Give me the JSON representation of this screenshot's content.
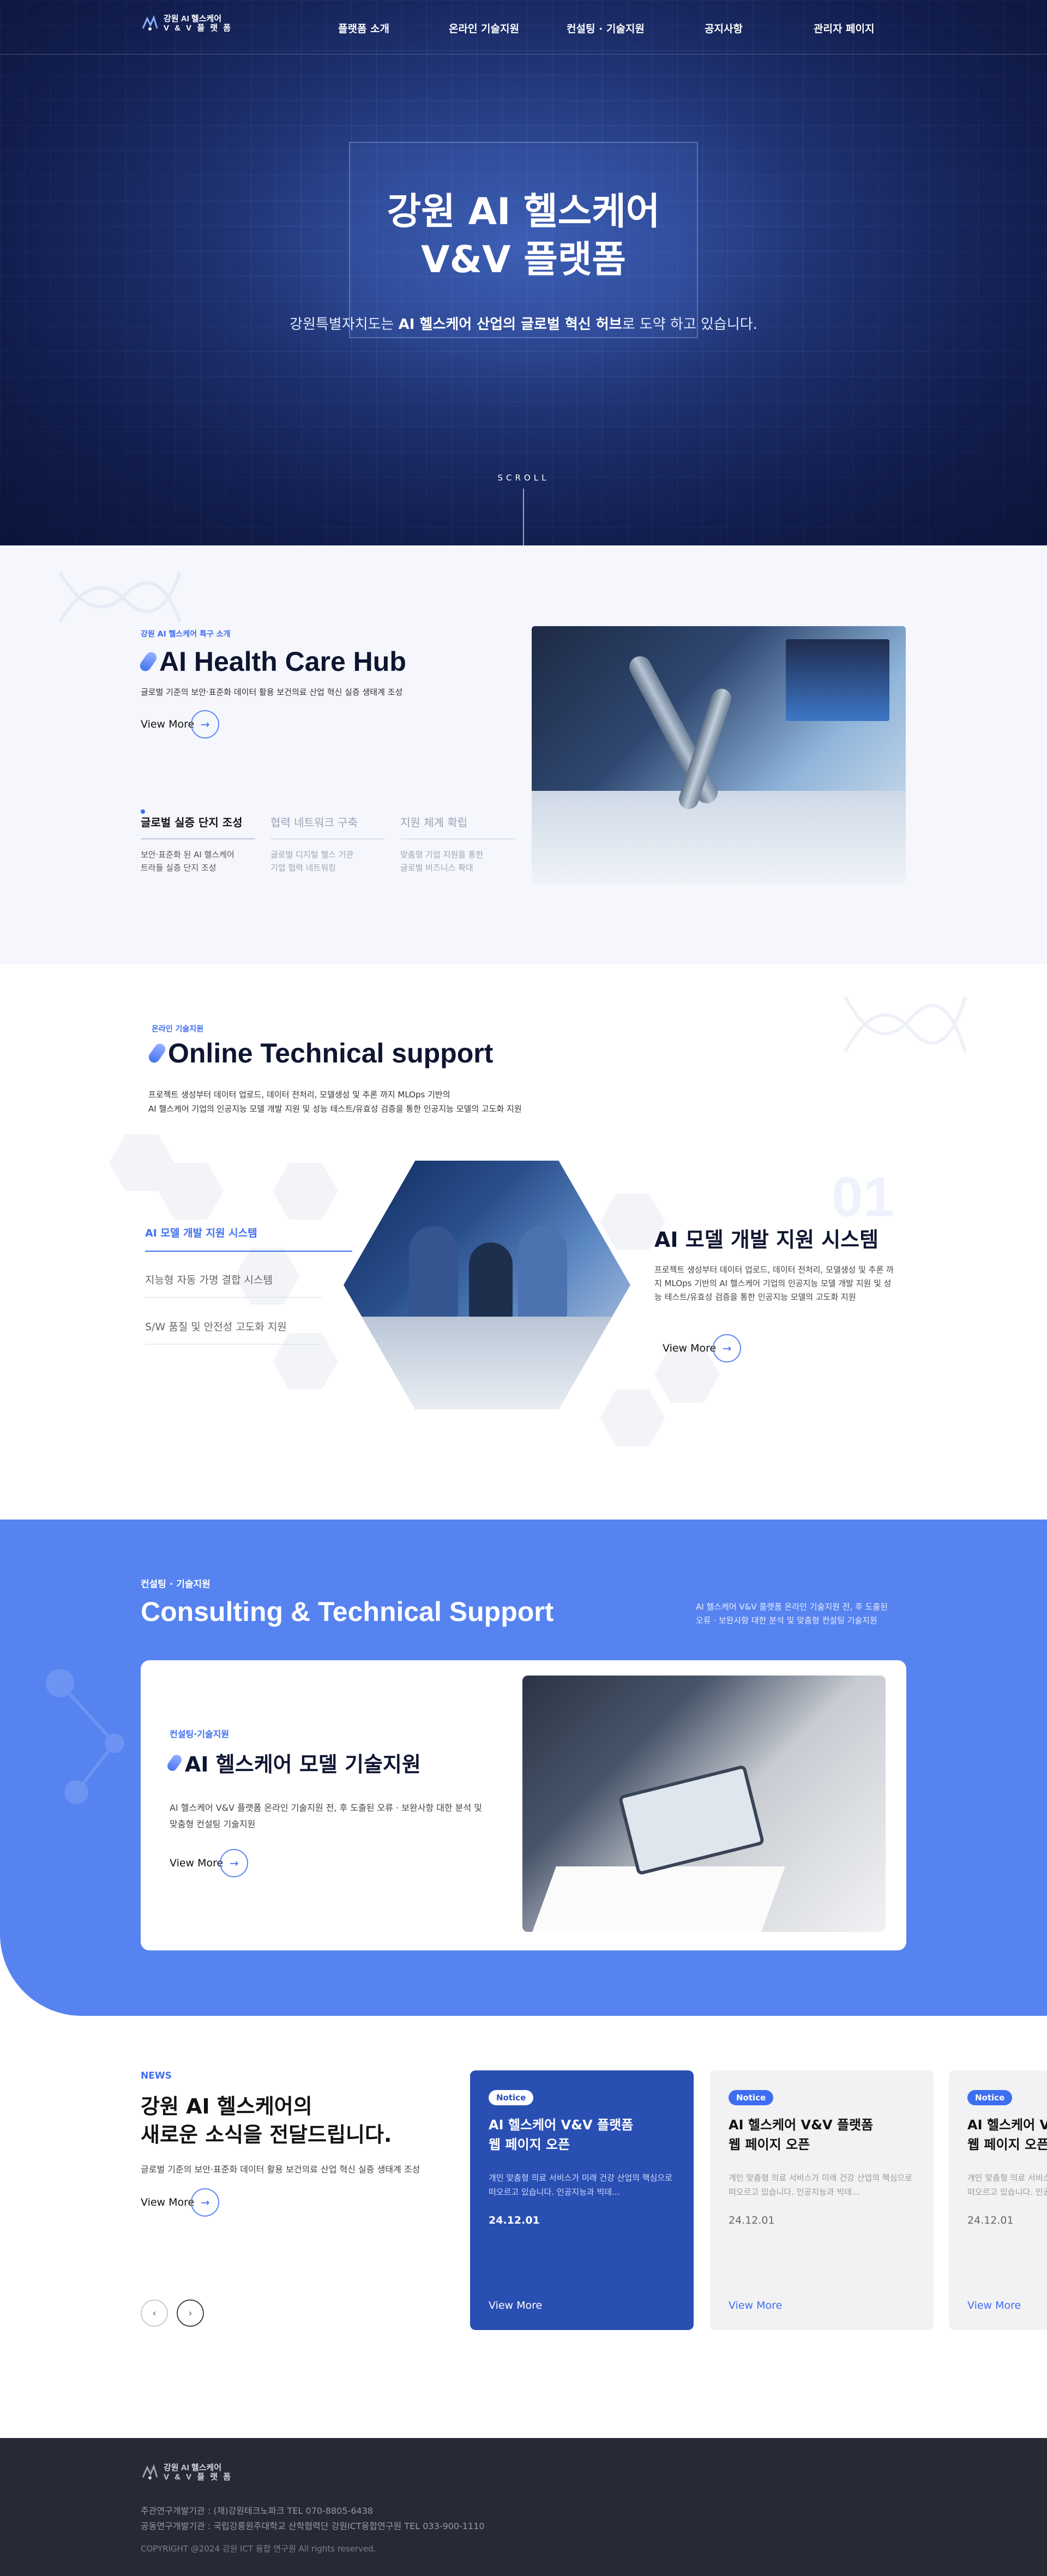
{
  "header": {
    "logo_line1": "강원 AI 헬스케어",
    "logo_line2": "V & V  플 랫 폼",
    "nav": [
      "플랫폼 소개",
      "온라인 기술지원",
      "컨설팅 · 기술지원",
      "공지사항",
      "관리자 페이지"
    ]
  },
  "hero": {
    "title_line1": "강원 AI 헬스케어",
    "title_line2": "V&V 플랫폼",
    "sub_pre": "강원특별자치도는 ",
    "sub_bold": "AI 헬스케어 산업의 글로벌 혁신 허브",
    "sub_post": "로 도약 하고 있습니다.",
    "scroll": "SCROLL"
  },
  "hub": {
    "eyebrow": "강원 AI 헬스케어 특구 소개",
    "title": "AI Health Care Hub",
    "desc": "글로벌 기준의 보안·표준화 데이터 활용 보건의료 산업 혁신 실증 생태계 조성",
    "view_more": "View More",
    "tabs": [
      {
        "title": "글로벌 실증 단지 조성",
        "desc_line1": "보안·표준화 된 AI 헬스케어",
        "desc_line2": "트라들 실증 단지 조성"
      },
      {
        "title": "협력 네트워크 구축",
        "desc_line1": "글로벌 디지털 헬스 기관",
        "desc_line2": "기업 협력 네트워킹"
      },
      {
        "title": "지원 체계 확립",
        "desc_line1": "맞춤형 기업 지원을 통한",
        "desc_line2": "글로벌 비즈니스 확대"
      }
    ]
  },
  "online": {
    "eyebrow": "온라인 기술지원",
    "title": "Online Technical support",
    "desc_line1": "프로젝트 생성부터 데이터 업로드, 데이터 전처리, 모델생성 및 추론 까지 MLOps 기반의",
    "desc_line2": "AI 헬스케어 기업의 인공지능 모델 개발 지원 및 성능 테스트/유효성 검증을 통한 인공지능 모델의 고도화 지원",
    "menu": [
      "AI 모델 개발 지원 시스템",
      "지능형 자동 가명 결합 시스템",
      "S/W 품질 및 안전성 고도화 지원"
    ],
    "number": "01",
    "detail_title": "AI 모델 개발 지원 시스템",
    "detail_desc": "프로젝트 생성부터 데이터 업로드, 데이터 전처리, 모델생성 및 추론 까지 MLOps 기반의 AI 헬스케어 기업의 인공지능 모델 개발 지원 및 성능 테스트/유효성 검증을 통한 인공지능 모델의 고도화 지원",
    "view_more": "View More"
  },
  "consult": {
    "eyebrow": "컨설팅 · 기술지원",
    "title": "Consulting & Technical Support",
    "right_line1": "AI 헬스케어 V&V 플랫폼 온라인 기술지원 전, 후 도출된",
    "right_line2": "오류 · 보완사항 대한 분석 및  맞춤형 컨설팅 기술지원",
    "card_eyebrow": "컨설팅·기술지원",
    "card_title": "AI 헬스케어 모델 기술지원",
    "card_desc_line1": "AI 헬스케어 V&V 플랫폼 온라인 기술지원 전, 후 도출된 오류 · 보완사항 대한 분석 및",
    "card_desc_line2": "맞춤형 컨설팅 기술지원",
    "view_more": "View More"
  },
  "news": {
    "eyebrow": "NEWS",
    "title_line1": "강원 AI 헬스케어의",
    "title_line2": "새로운 소식을 전달드립니다.",
    "desc": "글로벌 기준의 보안·표준화 데이터 활용 보건의료 산업 혁신 실증 생태계 조성",
    "view_more": "View More",
    "cards": [
      {
        "badge": "Notice",
        "title_line1": "AI 헬스케어 V&V 플랫폼",
        "title_line2": "웹 페이지 오픈",
        "desc": "개인 맞춤형 의료 서비스가 미래 건강 산업의 핵심으로 떠오르고 있습니다. 인공지능과 빅데...",
        "date": "24.12.01",
        "view_more": "View More"
      },
      {
        "badge": "Notice",
        "title_line1": "AI 헬스케어 V&V 플랫폼",
        "title_line2": "웹 페이지 오픈",
        "desc": "개인 맞춤형 의료 서비스가 미래 건강 산업의 핵심으로 떠오르고 있습니다. 인공지능과 빅데...",
        "date": "24.12.01",
        "view_more": "View More"
      },
      {
        "badge": "Notice",
        "title_line1": "AI 헬스케어 V&V 플랫폼",
        "title_line2": "웹 페이지 오픈",
        "desc": "개인 맞춤형 의료 서비스가 미래 건강 산업의 핵심으로 떠오르고 있습니다. 인공지능과 빅데...",
        "date": "24.12.01",
        "view_more": "View More"
      }
    ]
  },
  "footer": {
    "logo_line1": "강원 AI 헬스케어",
    "logo_line2": "V & V  플 랫 폼",
    "info_line1": "주관연구개발기관 : (재)강원테크노파크 TEL 070-8805-6438",
    "info_line2": "공동연구개발기관 : 국립강릉원주대학교 산학협력단 강원ICT융합연구원 TEL 033-900-1110",
    "copyright": "COPYRIGHT @2024 강원 ICT 융합 연구원 All rights reserved."
  },
  "colors": {
    "accent": "#3e6ef0",
    "hero_bg": "#1c2d6b",
    "consult_bg": "#5683f0",
    "footer_bg": "#272a36"
  },
  "icons": {
    "arrow": "arrow-right-icon",
    "prev": "chevron-left-icon",
    "next": "chevron-right-icon"
  }
}
